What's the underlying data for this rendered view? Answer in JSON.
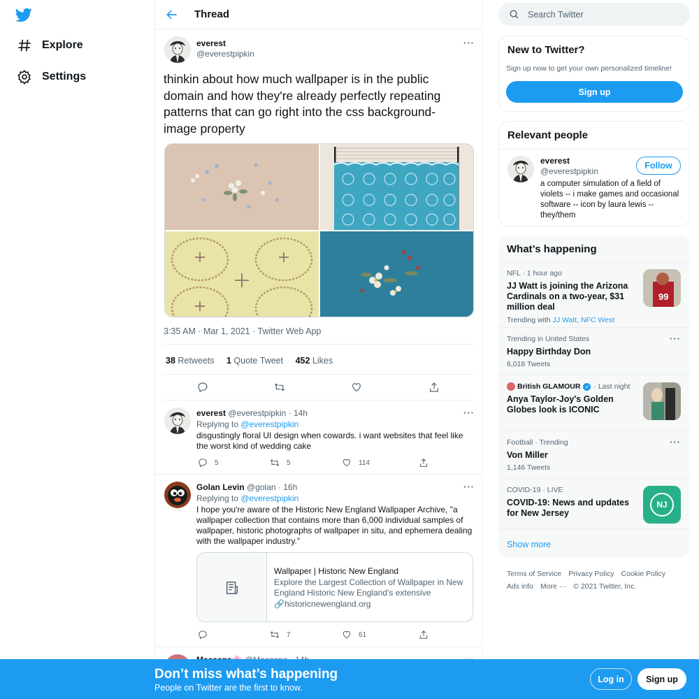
{
  "nav": {
    "explore_label": "Explore",
    "settings_label": "Settings"
  },
  "thread": {
    "title": "Thread"
  },
  "main_tweet": {
    "name": "everest",
    "handle": "@everestpipkin",
    "text": "thinkin about how much wallpaper is in the public domain and how they're already perfectly repeating patterns that can go right into the css background-image property",
    "timestamp": "3:35 AM · Mar 1, 2021 · Twitter Web App",
    "retweets_count": "38",
    "retweets_label": "Retweets",
    "quotes_count": "1",
    "quotes_label": "Quote Tweet",
    "likes_count": "452",
    "likes_label": "Likes"
  },
  "replies": [
    {
      "name": "everest",
      "meta": "@everestpipkin · 14h",
      "replying_prefix": "Replying to",
      "replying_to": "@everestpipkin",
      "text": "disgustingly floral UI design when cowards. i want websites that feel like the worst kind of wedding cake",
      "replies": "5",
      "retweets": "5",
      "likes": "114"
    },
    {
      "name": "Golan Levin",
      "meta": "@golan · 16h",
      "replying_prefix": "Replying to",
      "replying_to": "@everestpipkin",
      "text": "I hope you're aware of the Historic New England Wallpaper Archive, \"a wallpaper collection that contains more than 6,000 individual samples of wallpaper, historic photographs of wallpaper in situ, and ephemera dealing with the wallpaper industry.\"",
      "card": {
        "title": "Wallpaper | Historic New England",
        "description": "Explore the Largest Collection of Wallpaper in New England Historic New England's extensive wallpap…",
        "url": "historicnewengland.org"
      },
      "replies": "",
      "retweets": "7",
      "likes": "61"
    },
    {
      "name": "Macaana🌸",
      "meta": "@Macaana · 14h"
    }
  ],
  "search": {
    "placeholder": "Search Twitter"
  },
  "new_to_twitter": {
    "title": "New to Twitter?",
    "subtitle": "Sign up now to get your own personalized timeline!",
    "button": "Sign up"
  },
  "relevant_people": {
    "title": "Relevant people",
    "name": "everest",
    "handle": "@everestpipkin",
    "follow_label": "Follow",
    "bio": "a computer simulation of a field of violets -- i make games and occasional software -- icon by laura lewis -- they/them"
  },
  "whats_happening": {
    "title": "What’s happening",
    "trends": [
      {
        "meta": "NFL · 1 hour ago",
        "title": "JJ Watt is joining the Arizona Cardinals on a two-year, $31 million deal",
        "trending_with_label": "Trending with",
        "trending_with": "JJ Watt, NFC West"
      },
      {
        "meta": "Trending in United States",
        "title": "Happy Birthday Don",
        "count": "6,018 Tweets"
      },
      {
        "source": "British GLAMOUR",
        "time": "· Last night",
        "title": "Anya Taylor-Joy's Golden Globes look is ICONIC"
      },
      {
        "meta": "Football · Trending",
        "title": "Von Miller",
        "count": "1,146 Tweets"
      },
      {
        "meta": "COVID-19 · LIVE",
        "title": "COVID-19: News and updates for New Jersey",
        "badge": "NJ"
      }
    ],
    "show_more": "Show more"
  },
  "footer": {
    "terms": "Terms of Service",
    "privacy": "Privacy Policy",
    "cookie": "Cookie Policy",
    "ads": "Ads info",
    "more": "More ···",
    "copyright": "© 2021 Twitter, Inc."
  },
  "bottom_bar": {
    "title": "Don’t miss what’s happening",
    "subtitle": "People on Twitter are the first to know.",
    "login": "Log in",
    "signup": "Sign up"
  },
  "colors": {
    "accent": "#1d9bf0",
    "text": "#0f1419",
    "secondary": "#536471"
  }
}
